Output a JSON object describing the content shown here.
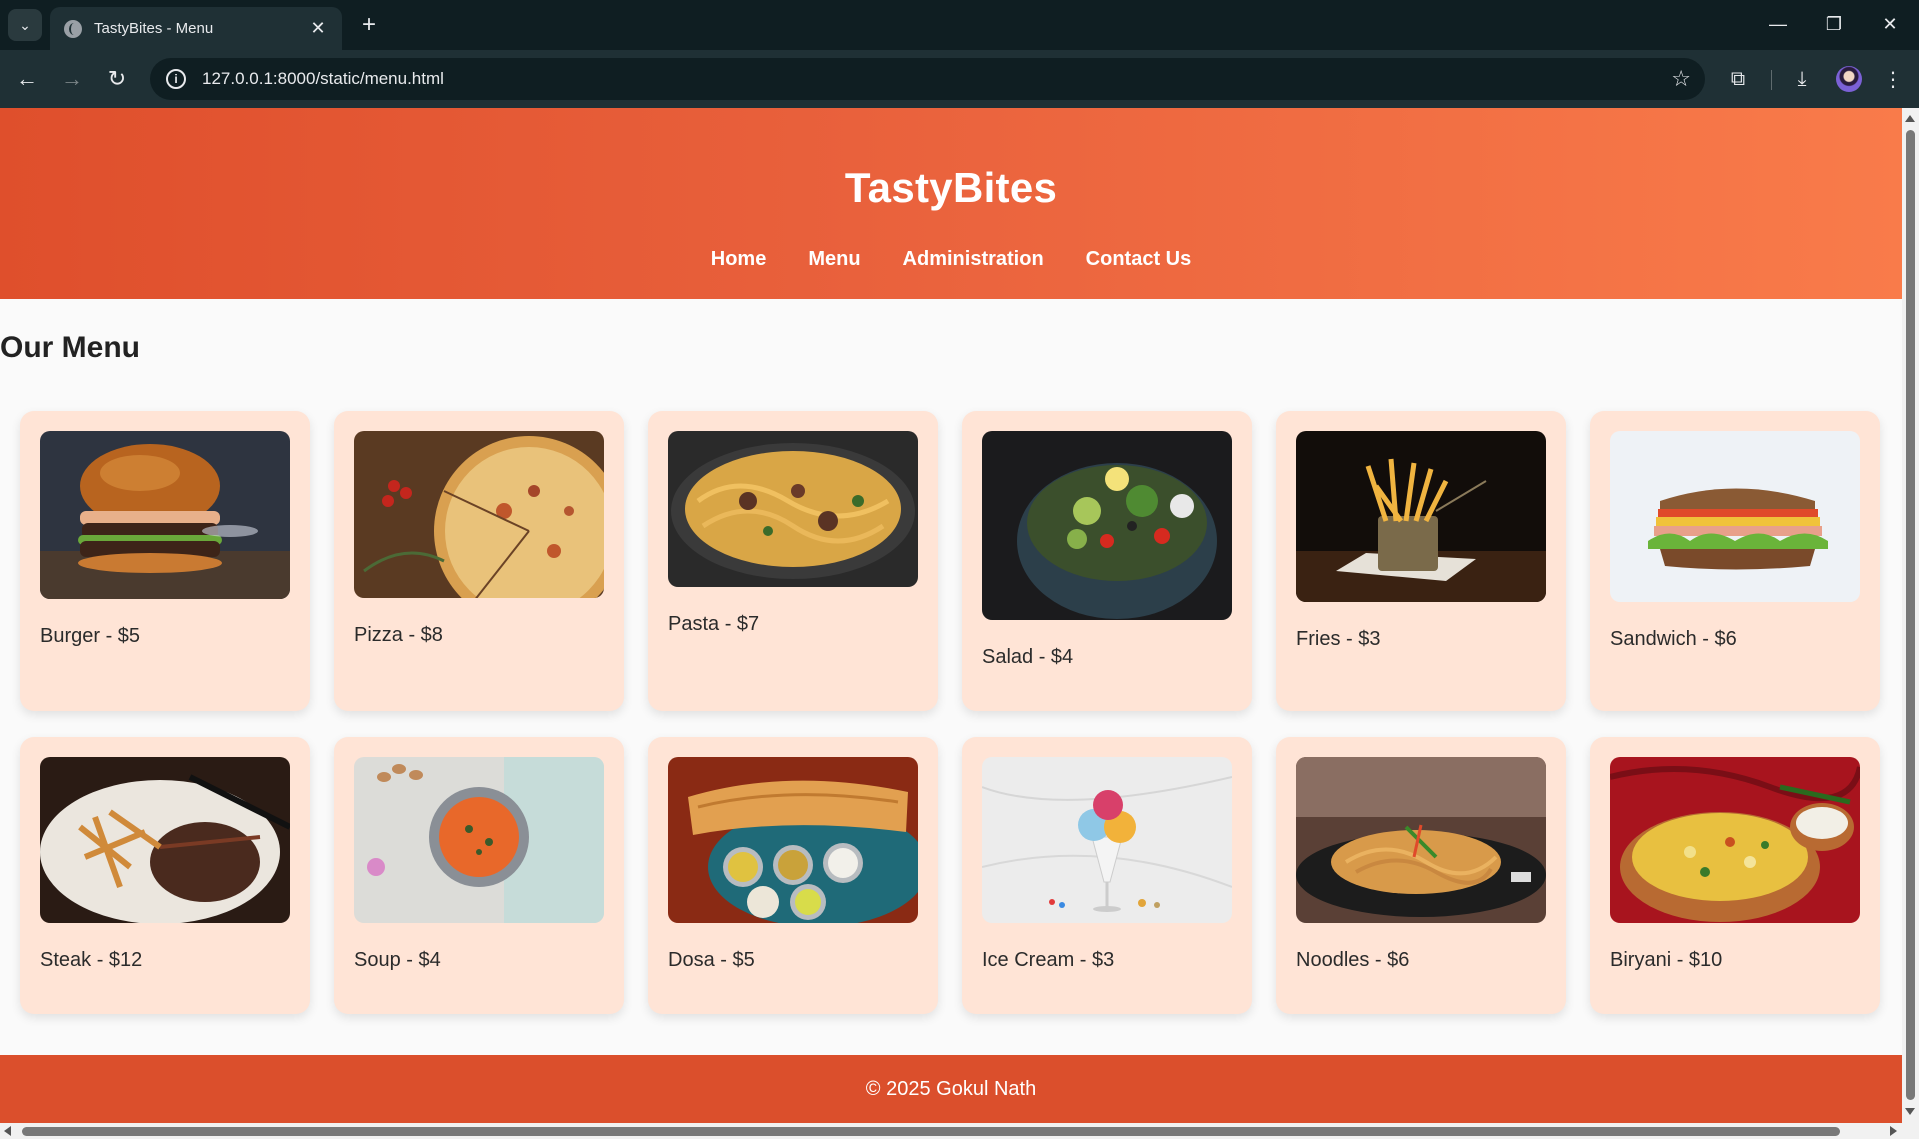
{
  "browser": {
    "tab_title": "TastyBites - Menu",
    "tab_close": "✕",
    "new_tab": "+",
    "url": "127.0.0.1:8000/static/menu.html",
    "icons": [
      "tab-search-icon",
      "globe-icon",
      "back-icon",
      "forward-icon",
      "reload-icon",
      "info-icon",
      "star-icon",
      "extensions-icon",
      "download-icon",
      "profile-avatar",
      "kebab-menu-icon",
      "minimize-icon",
      "restore-icon",
      "close-icon"
    ]
  },
  "site": {
    "title": "TastyBites",
    "nav": [
      "Home",
      "Menu",
      "Administration",
      "Contact Us"
    ],
    "heading": "Our Menu",
    "footer": "© 2025 Gokul Nath",
    "colors": {
      "header_start": "#df4f2c",
      "header_end": "#f97b4a",
      "card_bg": "#ffe4d6",
      "footer_bg": "#db4f2c"
    }
  },
  "menu": [
    {
      "label": "Burger - $5",
      "image": "burger"
    },
    {
      "label": "Pizza - $8",
      "image": "pizza"
    },
    {
      "label": "Pasta - $7",
      "image": "pasta"
    },
    {
      "label": "Salad - $4",
      "image": "salad"
    },
    {
      "label": "Fries - $3",
      "image": "fries"
    },
    {
      "label": "Sandwich - $6",
      "image": "sandwich"
    },
    {
      "label": "Steak - $12",
      "image": "steak"
    },
    {
      "label": "Soup - $4",
      "image": "soup"
    },
    {
      "label": "Dosa - $5",
      "image": "dosa"
    },
    {
      "label": "Ice Cream - $3",
      "image": "ice-cream"
    },
    {
      "label": "Noodles - $6",
      "image": "noodles"
    },
    {
      "label": "Biryani - $10",
      "image": "biryani"
    }
  ]
}
